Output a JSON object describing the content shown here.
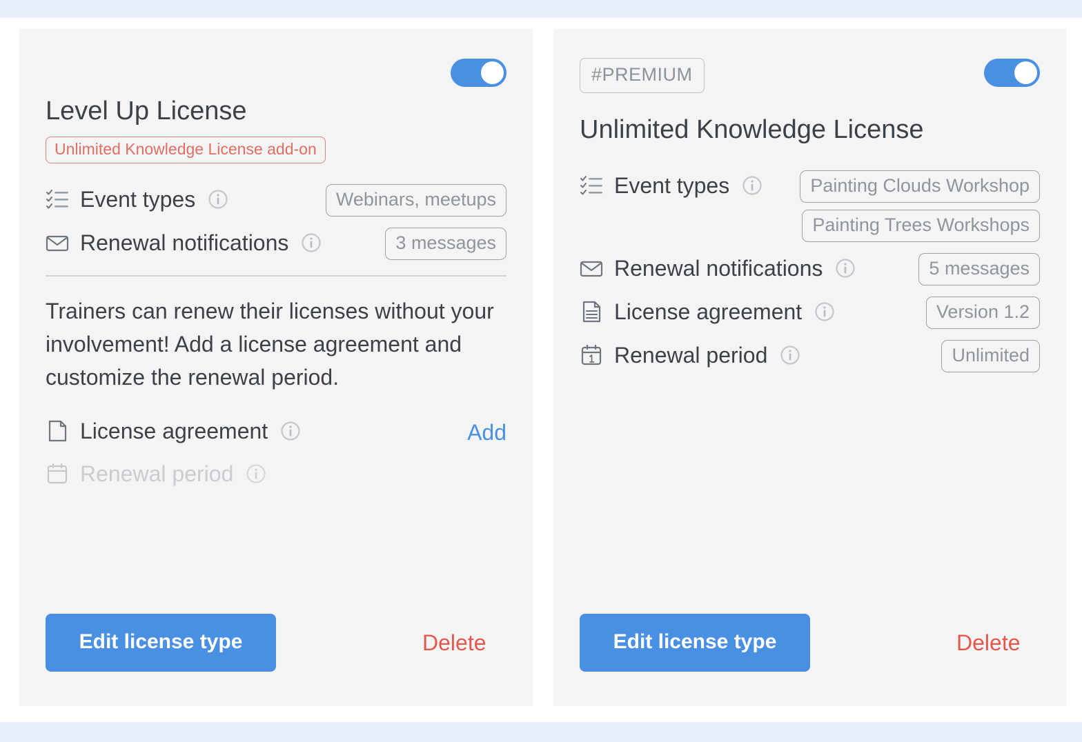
{
  "theme": {
    "accent": "#4a90e2",
    "danger": "#e2584d",
    "addon_border": "#d98079",
    "card_bg": "#f4f4f5",
    "band_bg": "#e8eefb",
    "text": "#3b4147",
    "muted": "#8f959d"
  },
  "cards": [
    {
      "id": "level-up-license",
      "toggle_on": true,
      "title": "Level Up License",
      "addon_badge": "Unlimited Knowledge License add-on",
      "rows": [
        {
          "icon": "checklist-icon",
          "label": "Event types",
          "info": true,
          "values": [
            "Webinars, meetups"
          ]
        },
        {
          "icon": "envelope-icon",
          "label": "Renewal notifications",
          "info": true,
          "values": [
            "3 messages"
          ]
        }
      ],
      "description": "Trainers can renew their licenses without your involvement! Add a license agreement and customize the renewal period.",
      "rows_after": [
        {
          "icon": "document-blank-icon",
          "label": "License agreement",
          "info": true,
          "link": "Add"
        },
        {
          "icon": "calendar-icon",
          "label": "Renewal period",
          "info": true,
          "disabled": true
        }
      ],
      "edit_label": "Edit license type",
      "delete_label": "Delete"
    },
    {
      "id": "unlimited-knowledge-license",
      "toggle_on": true,
      "premium_badge": "#PREMIUM",
      "title": "Unlimited Knowledge License",
      "rows": [
        {
          "icon": "checklist-icon",
          "label": "Event types",
          "info": true,
          "values": [
            "Painting Clouds Workshop",
            "Painting Trees Workshops"
          ]
        },
        {
          "icon": "envelope-icon",
          "label": "Renewal notifications",
          "info": true,
          "values": [
            "5 messages"
          ]
        },
        {
          "icon": "document-lines-icon",
          "label": "License agreement",
          "info": true,
          "values": [
            "Version 1.2"
          ]
        },
        {
          "icon": "calendar-icon",
          "label": "Renewal period",
          "info": true,
          "values": [
            "Unlimited"
          ]
        }
      ],
      "edit_label": "Edit license type",
      "delete_label": "Delete"
    }
  ]
}
